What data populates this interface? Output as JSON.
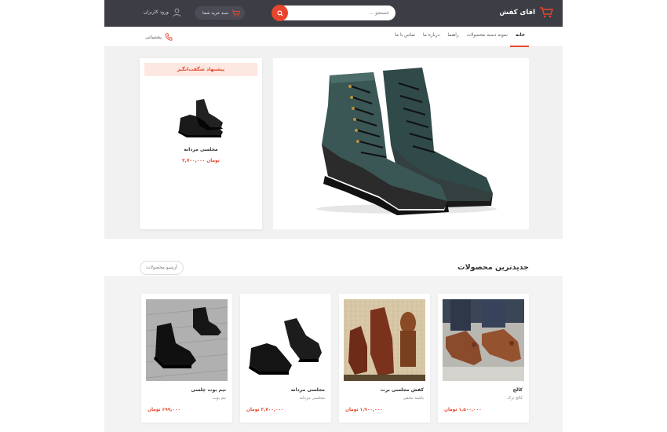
{
  "header": {
    "logo_text": "اقای کفش",
    "search_placeholder": "جستجو ...",
    "basket_label": "سبد خرید شما",
    "login_label": "ورود کاربران"
  },
  "nav": {
    "items": [
      {
        "label": "خانه"
      },
      {
        "label": "نمونه دسته محصولات"
      },
      {
        "label": "راهنما"
      },
      {
        "label": "درباره ما"
      },
      {
        "label": "تماس با ما"
      }
    ],
    "support_label": "پشتیبانی"
  },
  "offer": {
    "badge": "پیشنهاد شگفت‌انگیز",
    "name": "مجلسی مردانه",
    "price": "۲,۷۰۰,۰۰۰ تومان"
  },
  "newest": {
    "title": "جدیدترین محصولات",
    "archive_label": "آرشیو محصولات",
    "products": [
      {
        "name": "کالج",
        "subtitle": "کالج ترک",
        "price": "۱,۵۰۰,۰۰۰ تومان"
      },
      {
        "name": "کفش مجلسی برت",
        "subtitle": "پاشنه مخفی",
        "price": "۱,۹۰۰,۰۰۰ تومان"
      },
      {
        "name": "مجلسی مردانه",
        "subtitle": "مجلسی مردانه",
        "price": "۲,۷۰۰,۰۰۰ تومان"
      },
      {
        "name": "نیم بوت چلسی",
        "subtitle": "نیم بوت",
        "price": "۶۹۹,۰۰۰ تومان"
      }
    ]
  },
  "colors": {
    "header_bg": "#3c3d45",
    "accent": "#e8462c"
  }
}
